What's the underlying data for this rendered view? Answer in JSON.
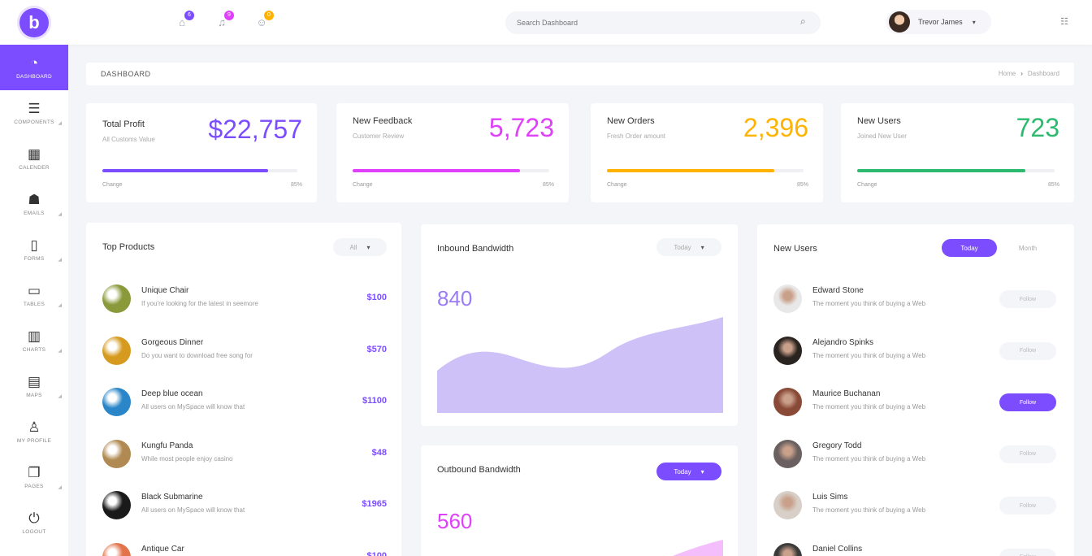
{
  "app": {
    "logo": "b"
  },
  "topbar": {
    "icons": [
      {
        "name": "home-icon",
        "glyph": "⌂",
        "badge": "6",
        "color": "#7c4dff"
      },
      {
        "name": "bell-icon",
        "glyph": "♫",
        "badge": "9",
        "color": "#e040fb"
      },
      {
        "name": "user-icon",
        "glyph": "☺",
        "badge": "0",
        "color": "#ffb300"
      }
    ],
    "search_placeholder": "Search Dashboard",
    "user_name": "Trevor James",
    "caret": "▾",
    "grid": "☷"
  },
  "sidebar": {
    "items": [
      {
        "label": "DASHBOARD",
        "glyph": "◔",
        "active": true,
        "arrow": false
      },
      {
        "label": "COMPONENTS",
        "glyph": "☰",
        "active": false,
        "arrow": true
      },
      {
        "label": "CALENDER",
        "glyph": "▦",
        "active": false,
        "arrow": false
      },
      {
        "label": "EMAILS",
        "glyph": "☗",
        "active": false,
        "arrow": true
      },
      {
        "label": "FORMS",
        "glyph": "▯",
        "active": false,
        "arrow": true
      },
      {
        "label": "TABLES",
        "glyph": "▭",
        "active": false,
        "arrow": true
      },
      {
        "label": "CHARTS",
        "glyph": "▥",
        "active": false,
        "arrow": true
      },
      {
        "label": "MAPS",
        "glyph": "▤",
        "active": false,
        "arrow": true
      },
      {
        "label": "MY PROFILE",
        "glyph": "♙",
        "active": false,
        "arrow": false
      },
      {
        "label": "PAGES",
        "glyph": "❐",
        "active": false,
        "arrow": true
      },
      {
        "label": "LOGOUT",
        "glyph": "⏻",
        "active": false,
        "arrow": false
      }
    ]
  },
  "breadcrumb": {
    "title": "DASHBOARD",
    "home": "Home",
    "sep": "›",
    "current": "Dashboard"
  },
  "stats": [
    {
      "title": "Total Profit",
      "subtitle": "All Customs Value",
      "value": "$22,757",
      "color": "#7c4dff",
      "progress": 0.85,
      "foot": "Change",
      "pct": "85%"
    },
    {
      "title": "New Feedback",
      "subtitle": "Customer Review",
      "value": "5,723",
      "color": "#e040fb",
      "progress": 0.85,
      "foot": "Change",
      "pct": "85%"
    },
    {
      "title": "New Orders",
      "subtitle": "Fresh Order amount",
      "value": "2,396",
      "color": "#ffb300",
      "progress": 0.85,
      "foot": "Change",
      "pct": "85%"
    },
    {
      "title": "New Users",
      "subtitle": "Joined New User",
      "value": "723",
      "color": "#2bba6e",
      "progress": 0.85,
      "foot": "Change",
      "pct": "85%"
    }
  ],
  "top_products": {
    "title": "Top Products",
    "filter": "All",
    "items": [
      {
        "name": "Unique Chair",
        "desc": "If you're looking for the latest in seemore",
        "price": "$100",
        "img": "#8a9a3a"
      },
      {
        "name": "Gorgeous Dinner",
        "desc": "Do you want to download free song for",
        "price": "$570",
        "img": "#d69a1f"
      },
      {
        "name": "Deep blue ocean",
        "desc": "All users on MySpace will know that",
        "price": "$1100",
        "img": "#2a86c8"
      },
      {
        "name": "Kungfu Panda",
        "desc": "While most people enjoy casino",
        "price": "$48",
        "img": "#b08a52"
      },
      {
        "name": "Black Submarine",
        "desc": "All users on MySpace will know that",
        "price": "$1965",
        "img": "#1a1a1a"
      },
      {
        "name": "Antique Car",
        "desc": "",
        "price": "$100",
        "img": "#e3734a"
      }
    ]
  },
  "inbound": {
    "title": "Inbound Bandwidth",
    "filter": "Today",
    "value": "840",
    "color": "#9b7cf5"
  },
  "outbound": {
    "title": "Outbound Bandwidth",
    "filter": "Today",
    "value": "560",
    "color": "#e040fb"
  },
  "new_users": {
    "title": "New Users",
    "tab_active": "Today",
    "tab_other": "Month",
    "items": [
      {
        "name": "Edward Stone",
        "desc": "The moment you think of buying a Web",
        "btn": "Follow",
        "on": false,
        "img": "#e8e8e8"
      },
      {
        "name": "Alejandro Spinks",
        "desc": "The moment you think of buying a Web",
        "btn": "Follow",
        "on": false,
        "img": "#2a2420"
      },
      {
        "name": "Maurice Buchanan",
        "desc": "The moment you think of buying a Web",
        "btn": "Follow",
        "on": true,
        "img": "#8a4a38"
      },
      {
        "name": "Gregory Todd",
        "desc": "The moment you think of buying a Web",
        "btn": "Follow",
        "on": false,
        "img": "#6a6060"
      },
      {
        "name": "Luis Sims",
        "desc": "The moment you think of buying a Web",
        "btn": "Follow",
        "on": false,
        "img": "#d8d0c8"
      },
      {
        "name": "Daniel Collins",
        "desc": "",
        "btn": "Follow",
        "on": false,
        "img": "#3a3a3a"
      }
    ]
  }
}
